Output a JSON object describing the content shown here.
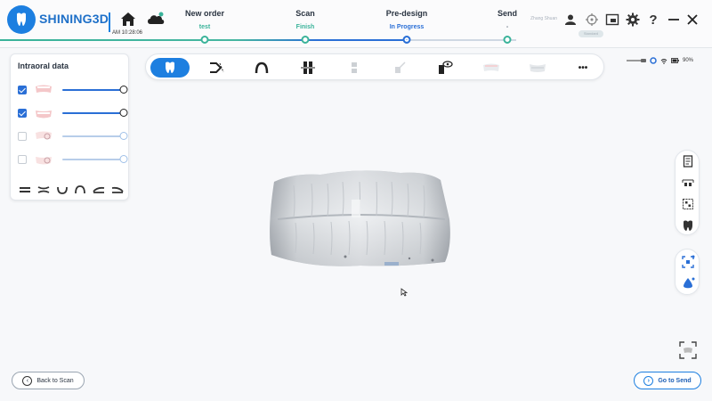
{
  "app": {
    "brand": "SHINING3D",
    "time": "AM 10:28:06"
  },
  "steps": [
    {
      "label": "New order",
      "status": "test",
      "state": "done"
    },
    {
      "label": "Scan",
      "status": "Finish",
      "state": "done"
    },
    {
      "label": "Pre-design",
      "status": "In Progress",
      "state": "active"
    },
    {
      "label": "Send",
      "status": "-",
      "state": "pending"
    }
  ],
  "user": {
    "name": "Zhang Shuan",
    "badge": "Standard"
  },
  "header_icons": [
    "user-icon",
    "target-icon",
    "screenshot-icon",
    "settings-icon",
    "help-icon",
    "minimize-icon",
    "close-icon"
  ],
  "intraoral_panel": {
    "title": "Intraoral data",
    "layers": [
      {
        "name": "upper-jaw",
        "checked": true,
        "opacity": 1.0
      },
      {
        "name": "lower-jaw",
        "checked": true,
        "opacity": 1.0
      },
      {
        "name": "upper-pre-op",
        "checked": false,
        "opacity": 1.0
      },
      {
        "name": "lower-pre-op",
        "checked": false,
        "opacity": 1.0
      }
    ],
    "view_icons": [
      "front-view-icon",
      "both-jaws-view-icon",
      "lower-view-icon",
      "upper-view-icon",
      "left-view-icon",
      "right-view-icon"
    ]
  },
  "toolbar": {
    "tools": [
      "tooth-tool-icon",
      "trim-tool-icon",
      "arch-tool-icon",
      "align-tool-icon",
      "bite-tool-icon",
      "brush-tool-icon",
      "inspect-tool-icon",
      "upper-model-icon",
      "lower-model-icon",
      "more-icon"
    ],
    "more": "•••"
  },
  "status": {
    "wifi": "wifi-icon",
    "battery": "90%"
  },
  "right_rail": [
    "report-icon",
    "measure-icon",
    "grid-icon",
    "tooth-info-icon"
  ],
  "right_rail2": [
    "focus-icon",
    "drop-icon"
  ],
  "buttons": {
    "back": "Back to Scan",
    "send": "Go to Send"
  }
}
